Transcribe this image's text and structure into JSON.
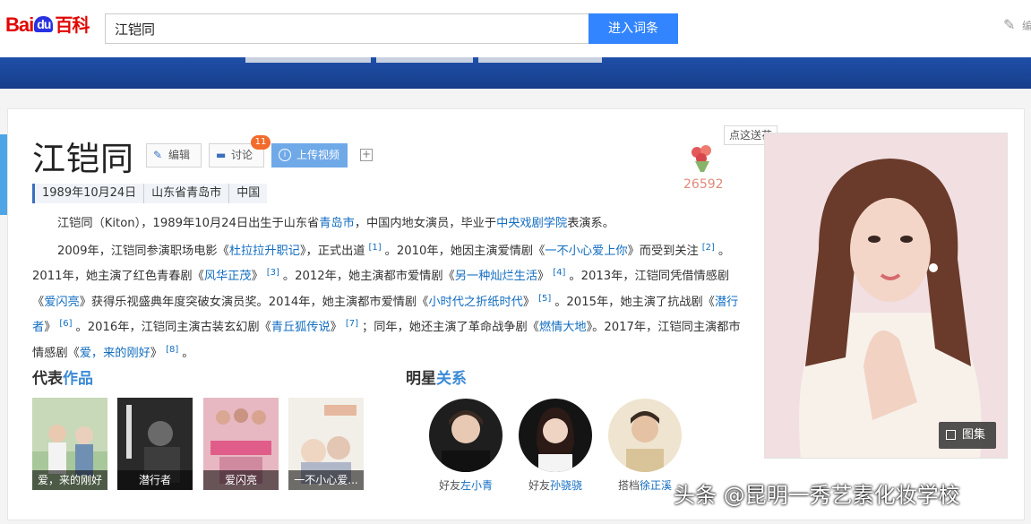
{
  "header": {
    "logo_bai": "Bai",
    "logo_du": "du",
    "logo_baike": "百科",
    "search_value": "江铠同",
    "search_button": "进入词条",
    "edit_text": "编"
  },
  "person": {
    "name": "江铠同",
    "edit_label": "编辑",
    "discuss_label": "讨论",
    "discuss_count": "11",
    "upload_label": "上传视频",
    "plus": "+",
    "flower_tip": "点这送花",
    "flower_count": "26592",
    "info": [
      "1989年10月24日",
      "山东省青岛市",
      "中国"
    ]
  },
  "summary": {
    "p1_a": "江铠同（Kiton），1989年10月24日出生于山东省",
    "p1_link1": "青岛市",
    "p1_b": "，中国内地女演员，毕业于",
    "p1_link2": "中央戏剧学院",
    "p1_c": "表演系。",
    "p2_a": "2009年，江铠同参演职场电影《",
    "p2_l1": "杜拉拉升职记",
    "p2_b": "》，正式出道",
    "r1": "[1]",
    "p2_c": "。2010年，她因主演爱情剧《",
    "p2_l2": "一不小心爱上你",
    "p2_d": "》而受到关注",
    "r2": "[2]",
    "p2_e": "。2011年，她主演了红色青春剧《",
    "p2_l3": "风华正茂",
    "p2_f": "》",
    "r3": "[3]",
    "p2_g": "。2012年，她主演都市爱情剧《",
    "p2_l4": "另一种灿烂生活",
    "p2_h": "》",
    "r4": "[4]",
    "p2_i": "。2013年，江铠同凭借情感剧《",
    "p2_l5": "爱闪亮",
    "p2_j": "》获得乐视盛典年度突破女演员奖。2014年，她主演都市爱情剧《",
    "p2_l6": "小时代之折纸时代",
    "p2_k": "》",
    "r5": "[5]",
    "p2_l": "。2015年，她主演了抗战剧《",
    "p2_l7": "潜行者",
    "p2_m": "》",
    "r6": "[6]",
    "p2_n": "。2016年，江铠同主演古装玄幻剧《",
    "p2_l8": "青丘狐传说",
    "p2_o": "》",
    "r7": "[7]",
    "p2_p": "；同年，她还主演了革命战争剧《",
    "p2_l9": "燃情大地",
    "p2_q": "》。2017年，江铠同主演都市情感剧《",
    "p2_l10": "爱，来的刚好",
    "p2_r": "》",
    "r8": "[8]",
    "p2_s": "。"
  },
  "works_section": {
    "title_a": "代表",
    "title_b": "作品",
    "items": [
      {
        "caption": "爱，来的刚好"
      },
      {
        "caption": "潜行者"
      },
      {
        "caption": "爱闪亮"
      },
      {
        "caption": "一不小心爱..."
      }
    ]
  },
  "relations_section": {
    "title_a": "明星",
    "title_b": "关系",
    "items": [
      {
        "relation": "好友",
        "name": "左小青"
      },
      {
        "relation": "好友",
        "name": "孙骁骁"
      },
      {
        "relation": "搭档",
        "name": "徐正溪"
      }
    ]
  },
  "album_label": "图集",
  "watermark": "头条 @昆明一秀艺素化妆学校"
}
